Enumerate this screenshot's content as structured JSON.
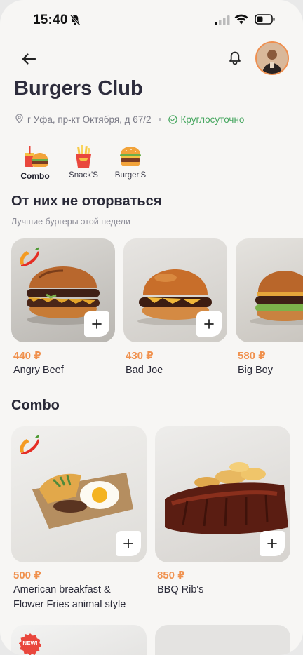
{
  "status": {
    "time": "15:40"
  },
  "restaurant": {
    "name": "Burgers Club",
    "address": "г Уфа, пр-кт Октября, д 67/2",
    "hours": "Круглосуточно"
  },
  "categories": [
    {
      "label": "Combo",
      "icon": "combo-icon",
      "active": true
    },
    {
      "label": "Snack'S",
      "icon": "fries-icon",
      "active": false
    },
    {
      "label": "Burger'S",
      "icon": "burger-icon",
      "active": false
    }
  ],
  "featured": {
    "title": "От них не оторваться",
    "subtitle": "Лучшие бургеры этой недели",
    "items": [
      {
        "price": "440 ₽",
        "name": "Angry Beef",
        "spicy": true
      },
      {
        "price": "430 ₽",
        "name": "Bad Joe",
        "spicy": false
      },
      {
        "price": "580 ₽",
        "name": "Big Boy",
        "spicy": false
      }
    ]
  },
  "combo": {
    "title": "Combo",
    "items": [
      {
        "price": "500 ₽",
        "name": "American breakfast & Flower Fries animal style",
        "spicy": true
      },
      {
        "price": "850 ₽",
        "name": "BBQ Rib's",
        "spicy": false
      }
    ]
  },
  "badges": {
    "new": "NEW!"
  },
  "colors": {
    "accent": "#f0914e",
    "open": "#47a760",
    "title": "#2d2c3c"
  }
}
